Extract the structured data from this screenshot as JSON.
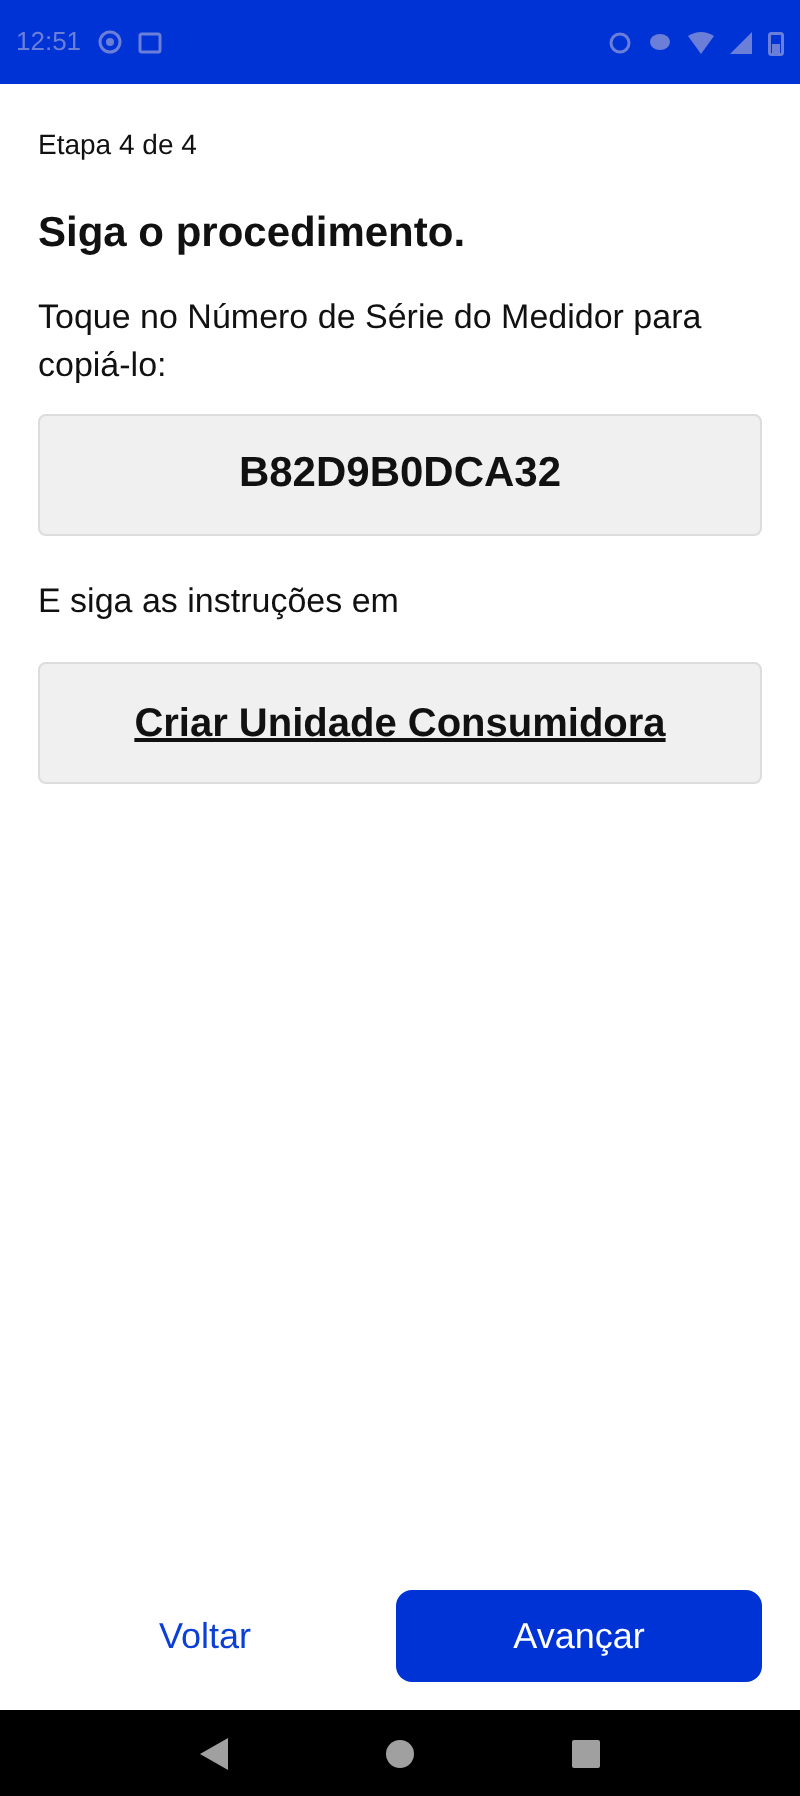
{
  "status_bar": {
    "time": "12:51"
  },
  "step": "Etapa 4 de 4",
  "title": "Siga o procedimento.",
  "instruction": "Toque no Número de Série do Medidor para copiá-lo:",
  "serial_number": "B82D9B0DCA32",
  "follow_text": "E siga as instruções em",
  "link": "Criar Unidade Consumidora",
  "buttons": {
    "back": "Voltar",
    "next": "Avançar"
  }
}
